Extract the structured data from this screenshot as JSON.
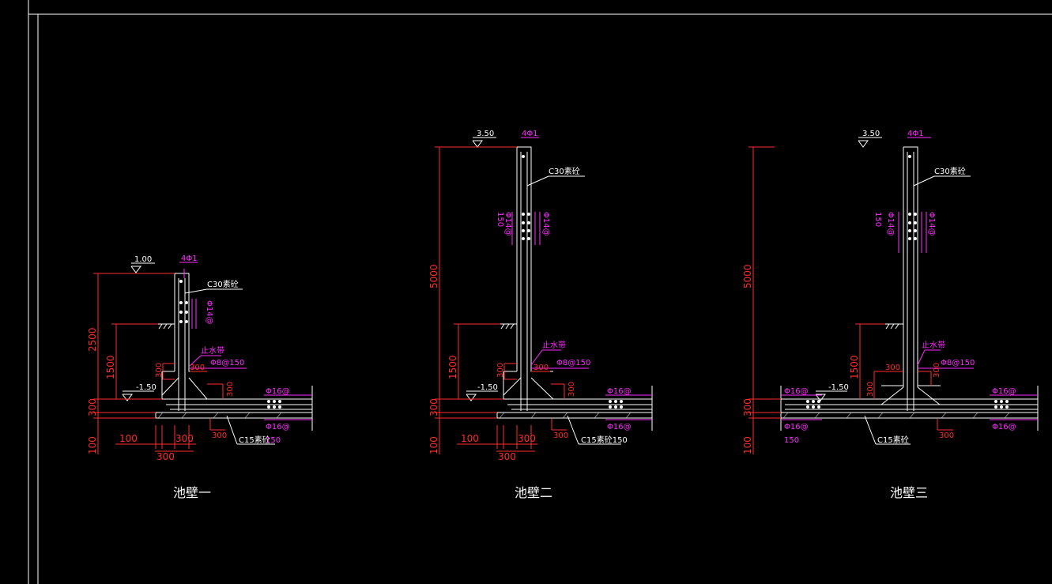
{
  "drawings": [
    {
      "title": "池壁一",
      "elev_top": "1.00",
      "elev_bottom": "-1.50",
      "top_rebar": "4Φ1",
      "concrete_wall": "C30素砼",
      "wall_rebar": "Φ14@",
      "waterstop": "止水带",
      "rebar_8": "Φ8@150",
      "rebar_16_top": "Φ16@",
      "rebar_16_bot": "Φ16@",
      "rebar_spacing": "150",
      "pad_concrete": "C15素砼",
      "dims_vertical": [
        "2500",
        "1500",
        "300",
        "100"
      ],
      "dims_300": [
        "300",
        "300",
        "300",
        "300"
      ],
      "dims_bottom": [
        "100",
        "300",
        "300"
      ]
    },
    {
      "title": "池壁二",
      "elev_top": "3.50",
      "elev_bottom": "-1.50",
      "top_rebar": "4Φ1",
      "concrete_wall": "C30素砼",
      "wall_rebar_l": "Φ14@",
      "wall_rebar_r": "Φ14@",
      "wall_spacing": "150",
      "waterstop": "止水带",
      "rebar_8": "Φ8@150",
      "rebar_16_top": "Φ16@",
      "rebar_16_bot": "Φ16@",
      "pad_concrete": "C15素砼150",
      "dims_vertical": [
        "5000",
        "1500",
        "300",
        "100"
      ],
      "dims_300": [
        "300",
        "300",
        "300",
        "300"
      ],
      "dims_bottom": [
        "100",
        "300",
        "300"
      ]
    },
    {
      "title": "池壁三",
      "elev_top": "3.50",
      "elev_bottom": "-1.50",
      "top_rebar": "4Φ1",
      "concrete_wall": "C30素砼",
      "wall_rebar_l": "Φ14@",
      "wall_rebar_r": "Φ14@",
      "wall_spacing": "150",
      "waterstop": "止水带",
      "rebar_8": "Φ8@150",
      "rebar_16_left_top": "Φ16@",
      "rebar_16_left_bot": "Φ16@",
      "rebar_16_right_top": "Φ16@",
      "rebar_16_right_bot": "Φ16@",
      "rebar_spacing": "150",
      "pad_concrete": "C15素砼",
      "dims_vertical": [
        "5000",
        "1500",
        "300",
        "100"
      ],
      "dims_300": [
        "300",
        "300",
        "300",
        "300"
      ]
    }
  ],
  "colors": {
    "background": "#000000",
    "outline": "#ffffff",
    "dimension": "#ff2b2b",
    "rebar": "#ff2bff"
  }
}
